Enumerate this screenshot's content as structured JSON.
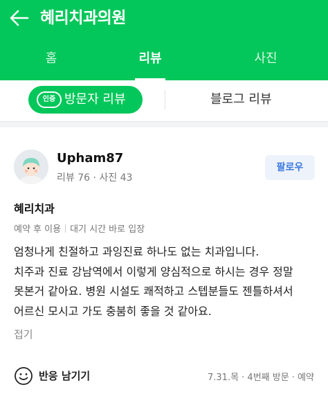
{
  "header": {
    "title": "혜리치과의원",
    "back_icon": "arrow-left-icon"
  },
  "tabs": [
    {
      "label": "홈",
      "active": false
    },
    {
      "label": "리뷰",
      "active": true
    },
    {
      "label": "사진",
      "active": false
    }
  ],
  "subtabs": {
    "cert_badge": "인증",
    "visitor_review": "방문자 리뷰",
    "blog_review": "블로그 리뷰"
  },
  "review": {
    "user": {
      "name": "Upham87",
      "stats": "리뷰 76 · 사진 43"
    },
    "follow_label": "팔로우",
    "place": "혜리치과",
    "tag1": "예약 후 이용",
    "tag2": "대기 시간 바로 입장",
    "body_lines": [
      "엄청나게 친절하고 과잉진료 하나도 없는 치과입니다.",
      "치주과 진료 강남역에서 이렇게 양심적으로 하시는 경우 정말",
      "못본거 같아요. 병원 시설도 쾌적하고 스텝분들도 젠틀하셔서",
      "어르신 모시고 가도 충붐히 좋을 것 같아요."
    ],
    "fold_label": "접기",
    "reaction_label": "반응 남기기",
    "visit_meta": "7.31.목 · 4번째 방문 · 예약"
  },
  "colors": {
    "brand": "#03c75a",
    "follow_text": "#3b7ae0",
    "follow_bg": "#eef3fb"
  }
}
